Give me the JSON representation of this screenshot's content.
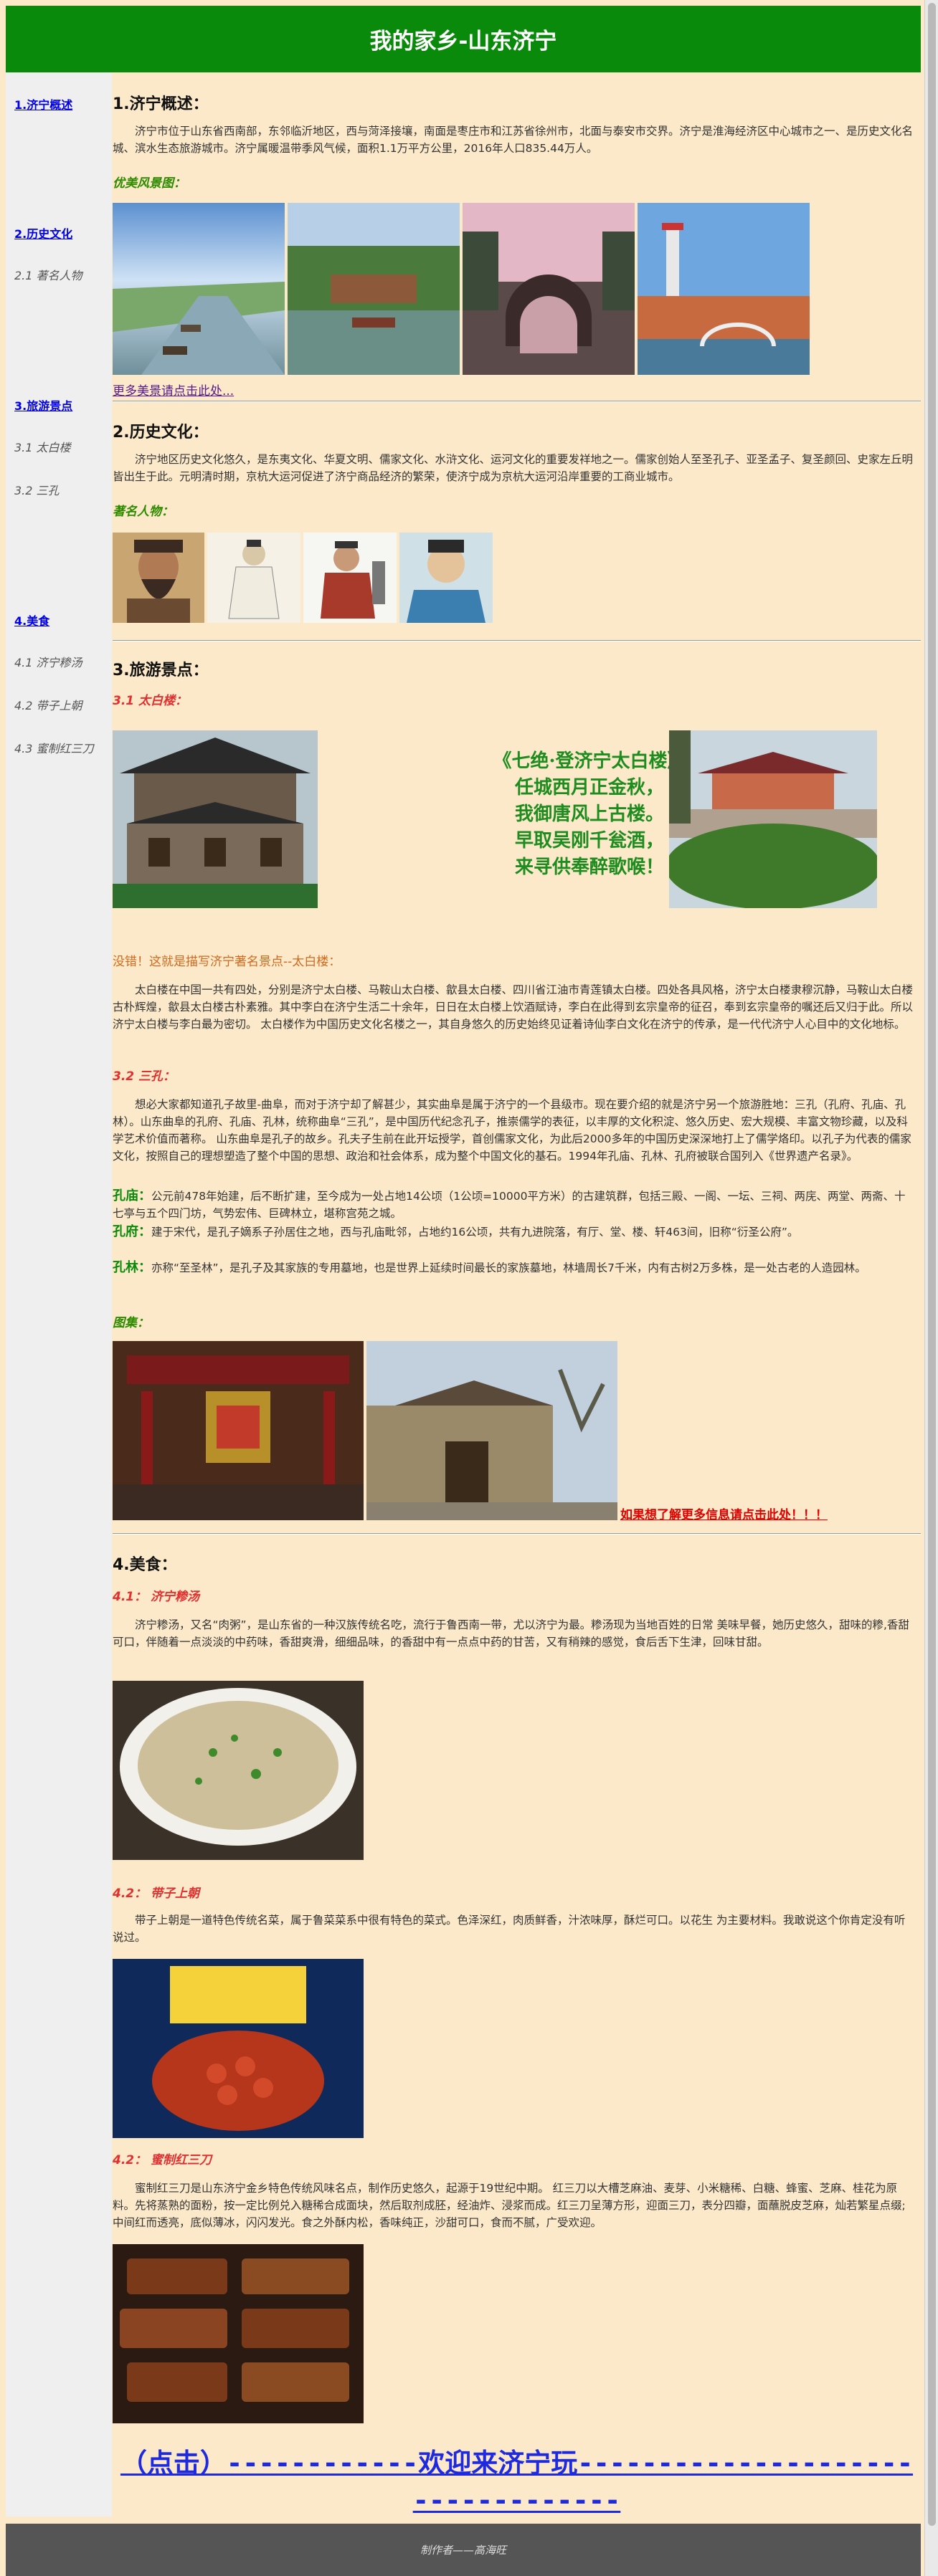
{
  "header": {
    "title": "我的家乡-山东济宁"
  },
  "sidebar": {
    "items": [
      {
        "label": "1.济宁概述",
        "type": "main"
      },
      {
        "label": "2.历史文化",
        "type": "main"
      },
      {
        "label": "2.1 著名人物",
        "type": "sub"
      },
      {
        "label": "3.旅游景点",
        "type": "main"
      },
      {
        "label": "3.1 太白楼",
        "type": "sub"
      },
      {
        "label": "3.2 三孔",
        "type": "sub"
      },
      {
        "label": "4.美食",
        "type": "main"
      },
      {
        "label": "4.1 济宁糁汤",
        "type": "sub"
      },
      {
        "label": "4.2 带子上朝",
        "type": "sub"
      },
      {
        "label": "4.3 蜜制红三刀",
        "type": "sub"
      }
    ]
  },
  "section1": {
    "title": "1.济宁概述：",
    "text": "济宁市位于山东省西南部，东邻临沂地区，西与菏泽接壤，南面是枣庄市和江苏省徐州市，北面与泰安市交界。济宁是淮海经济区中心城市之一、是历史文化名城、滨水生态旅游城市。济宁属暖温带季风气候，面积1.1万平方公里，2016年人口835.44万人。",
    "gallery_label": "优美风景图：",
    "more_link": "更多美景请点击此处..."
  },
  "section2": {
    "title": "2.历史文化：",
    "text": "济宁地区历史文化悠久，是东夷文化、华夏文明、儒家文化、水浒文化、运河文化的重要发祥地之一。儒家创始人至圣孔子、亚圣孟子、复圣颜回、史家左丘明皆出生于此。元明清时期，京杭大运河促进了济宁商品经济的繁荣，使济宁成为京杭大运河沿岸重要的工商业城市。",
    "people_label": "著名人物："
  },
  "section3": {
    "title": "3.旅游景点：",
    "sub1": "3.1 太白楼：",
    "poem": [
      "《七绝·登济宁太白楼》",
      "任城西月正金秋，",
      "我御唐风上古楼。",
      "早取吴刚千瓮酒，",
      "来寻供奉醉歌喉！"
    ],
    "taibai_intro": "没错！这就是描写济宁著名景点--太白楼：",
    "taibai_text": "太白楼在中国一共有四处，分别是济宁太白楼、马鞍山太白楼、歙县太白楼、四川省江油市青莲镇太白楼。四处各具风格，济宁太白楼隶穆沉静，马鞍山太白楼古朴辉煌，歙县太白楼古朴素雅。其中李白在济宁生活二十余年，日日在太白楼上饮酒赋诗，李白在此得到玄宗皇帝的征召，奉到玄宗皇帝的嘱还后又归于此。所以济宁太白楼与李白最为密切。 太白楼作为中国历史文化名楼之一，其自身悠久的历史始终见证着诗仙李白文化在济宁的传承，是一代代济宁人心目中的文化地标。",
    "sub2": "3.2 三孔：",
    "sankong_text": "想必大家都知道孔子故里-曲阜，而对于济宁却了解甚少，其实曲阜是属于济宁的一个县级市。现在要介绍的就是济宁另一个旅游胜地：三孔（孔府、孔庙、孔林）。山东曲阜的孔府、孔庙、孔林，统称曲阜“三孔”，是中国历代纪念孔子，推崇儒学的表征，以丰厚的文化积淀、悠久历史、宏大规模、丰富文物珍藏，以及科学艺术价值而著称。 山东曲阜是孔子的故乡。孔夫子生前在此开坛授学，首创儒家文化，为此后2000多年的中国历史深深地打上了儒学烙印。以孔子为代表的儒家文化，按照自己的理想塑造了整个中国的思想、政治和社会体系，成为整个中国文化的基石。1994年孔庙、孔林、孔府被联合国列入《世界遗产名录》。",
    "kongmiao_label": "孔庙：",
    "kongmiao_text": "公元前478年始建，后不断扩建，至今成为一处占地14公顷（1公顷=10000平方米）的古建筑群，包括三殿、一阁、一坛、三祠、两庑、两堂、两斋、十七亭与五个四门坊，气势宏伟、巨碑林立，堪称宫苑之城。",
    "kongfu_label": "孔府：",
    "kongfu_text": "建于宋代，是孔子嫡系子孙居住之地，西与孔庙毗邻，占地约16公顷，共有九进院落，有厅、堂、楼、轩463间，旧称“衍圣公府”。",
    "konglin_label": "孔林：",
    "konglin_text": "亦称“至圣林”，是孔子及其家族的专用墓地，也是世界上延续时间最长的家族墓地，林墙周长7千米，内有古树2万多株，是一处古老的人造园林。",
    "pics_label": "图集：",
    "more_info_link": "如果想了解更多信息请点击此处！！！"
  },
  "section4": {
    "title": "4.美食：",
    "sub1": "4.1： 济宁糁汤",
    "sub1_text": "济宁糁汤，又名“肉粥”，是山东省的一种汉族传统名吃，流行于鲁西南一带，尤以济宁为最。糁汤现为当地百姓的日常 美味早餐，她历史悠久，甜味的糁,香甜可口，伴随着一点淡淡的中药味，香甜爽滑，细细品味，的香甜中有一点点中药的甘苦，又有稍辣的感觉，食后舌下生津，回味甘甜。",
    "sub2": "4.2： 带子上朝",
    "sub2_text": "带子上朝是一道特色传统名菜，属于鲁菜菜系中很有特色的菜式。色泽深红，肉质鲜香，汁浓味厚，酥烂可口。以花生 为主要材料。我敢说这个你肯定没有听说过。",
    "sub3": "4.2： 蜜制红三刀",
    "sub3_text": "蜜制红三刀是山东济宁金乡特色传统风味名点，制作历史悠久，起源于19世纪中期。 红三刀以大槽芝麻油、麦芽、小米糖稀、白糖、蜂蜜、芝麻、桂花为原料。先将蒸熟的面粉，按一定比例兑入糖稀合成面块，然后取剂成胚，经油炸、浸浆而成。红三刀呈薄方形，迎面三刀，表分四瓣，面蘸脱皮芝麻，灿若繁星点缀;中间红而透亮，底似薄冰，闪闪发光。食之外酥内松，香味纯正，沙甜可口，食而不腻，广受欢迎。",
    "welcome_link": "（点击）------------欢迎来济宁玩----------------------------------"
  },
  "footer": {
    "text": "制作者——高海旺"
  }
}
